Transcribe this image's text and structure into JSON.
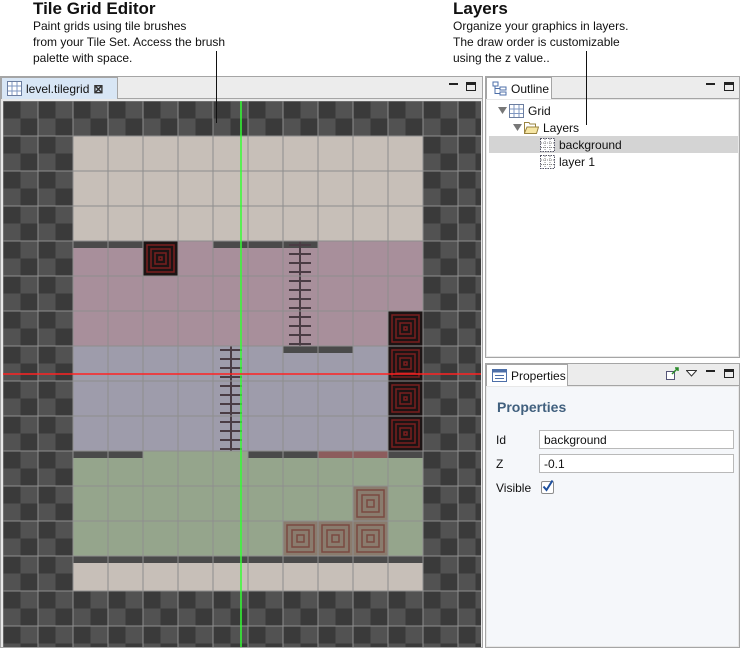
{
  "annotations": {
    "editor": {
      "title": "Tile Grid Editor",
      "desc1": "Paint grids using tile brushes",
      "desc2": "from your Tile Set. Access the brush",
      "desc3": "palette with space."
    },
    "layers": {
      "title": "Layers",
      "desc1": "Organize your graphics in layers.",
      "desc2": "The draw order is customizable",
      "desc3": "using the z value.."
    }
  },
  "editor": {
    "tab_label": "level.tilegrid",
    "colors": {
      "checker_dark": "#3a3a3a",
      "checker_light": "#525252",
      "grid_line": "#8e8e8e",
      "beige": "#c7bfb8",
      "pink": "#a88f9b",
      "lavender": "#9e9cab",
      "green": "#95a58c",
      "ledge": "#4a4a4a",
      "guide_green": "#33ff33",
      "guide_red": "#ff2222"
    }
  },
  "outline": {
    "tab_label": "Outline",
    "tree": {
      "grid": "Grid",
      "layers": "Layers",
      "background": "background",
      "layer1": "layer 1"
    }
  },
  "properties": {
    "tab_label": "Properties",
    "title": "Properties",
    "id_label": "Id",
    "id_value": "background",
    "z_label": "Z",
    "z_value": "-0.1",
    "visible_label": "Visible",
    "visible_checked": true
  }
}
